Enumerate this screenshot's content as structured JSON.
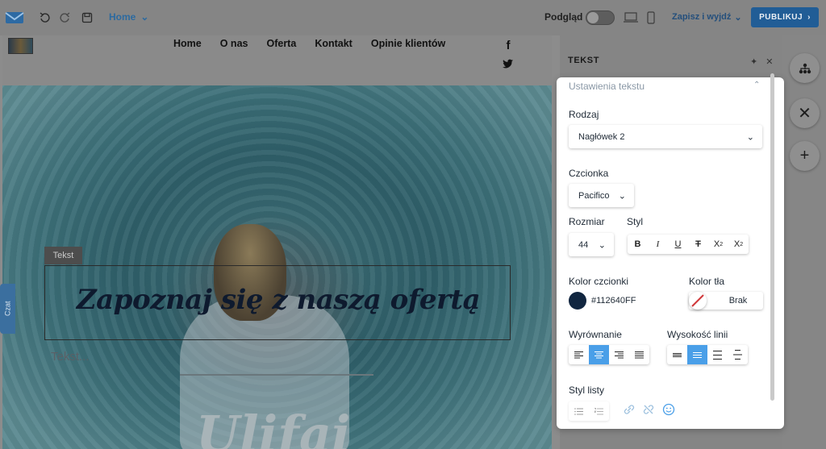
{
  "topbar": {
    "page_select": "Home",
    "preview_label": "Podgląd",
    "save_exit": "Zapisz i wyjdź",
    "publish": "PUBLIKUJ"
  },
  "site": {
    "nav": [
      "Home",
      "O nas",
      "Oferta",
      "Kontakt",
      "Opinie klientów"
    ],
    "text_tag": "Tekst",
    "headline": "Zapoznaj się z naszą ofertą",
    "placeholder": "Tekst...",
    "next_heading_fragment": "Ulifai",
    "chat_label": "Czat"
  },
  "side_panel": {
    "title": "TEKST"
  },
  "text_settings": {
    "section_title": "Ustawienia tekstu",
    "type_label": "Rodzaj",
    "type_value": "Nagłówek 2",
    "font_label": "Czcionka",
    "font_value": "Pacifico",
    "size_label": "Rozmiar",
    "size_value": "44",
    "style_label": "Styl",
    "style_buttons": [
      "B",
      "I",
      "U",
      "T",
      "X",
      "X"
    ],
    "font_color_label": "Kolor czcionki",
    "font_color_value": "#112640FF",
    "bg_color_label": "Kolor tła",
    "bg_color_value": "Brak",
    "align_label": "Wyrównanie",
    "line_height_label": "Wysokość linii",
    "list_style_label": "Styl listy"
  },
  "colors": {
    "font_color": "#112640",
    "accent": "#4a9fe8",
    "publish_bg": "#215d96"
  }
}
